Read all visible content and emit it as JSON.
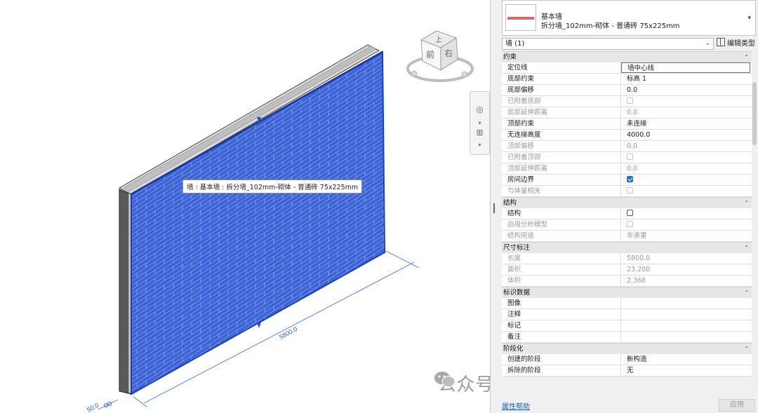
{
  "viewport": {
    "tooltip": "墙 : 基本墙 : 拆分墙_102mm-砌体 - 普通砖 75x225mm",
    "dimension_length": "5800.0",
    "dimension_thickness": "50.0",
    "viewcube": {
      "top": "上",
      "front": "前",
      "right": "右"
    },
    "watermark": "公众号 · Revit二次开发教程",
    "colors": {
      "wall_face": "#3d64d6",
      "brick_lines": "#8fa5e8",
      "dimension": "#3f6fd8"
    }
  },
  "properties": {
    "type_family": "基本墙",
    "type_name": "拆分墙_102mm-砌体 - 普通砖 75x225mm",
    "instance_filter": "墙 (1)",
    "edit_type_label": "编辑类型",
    "sections": [
      {
        "title": "约束",
        "rows": [
          {
            "k": "定位线",
            "v": "墙中心线",
            "state": "edit"
          },
          {
            "k": "底部约束",
            "v": "标高 1",
            "state": "normal"
          },
          {
            "k": "底部偏移",
            "v": "0.0",
            "state": "normal"
          },
          {
            "k": "已附着底部",
            "v": "",
            "state": "dim",
            "check": "off"
          },
          {
            "k": "底部延伸距离",
            "v": "0.0",
            "state": "dim"
          },
          {
            "k": "顶部约束",
            "v": "未连接",
            "state": "normal"
          },
          {
            "k": "无连接高度",
            "v": "4000.0",
            "state": "normal"
          },
          {
            "k": "顶部偏移",
            "v": "0.0",
            "state": "dim"
          },
          {
            "k": "已附着顶部",
            "v": "",
            "state": "dim",
            "check": "off"
          },
          {
            "k": "顶部延伸距离",
            "v": "0.0",
            "state": "dim"
          },
          {
            "k": "房间边界",
            "v": "",
            "state": "normal",
            "check": "on"
          },
          {
            "k": "与体量相关",
            "v": "",
            "state": "dim",
            "check": "off"
          }
        ]
      },
      {
        "title": "结构",
        "rows": [
          {
            "k": "结构",
            "v": "",
            "state": "normal",
            "check": "off"
          },
          {
            "k": "启用分析模型",
            "v": "",
            "state": "dim",
            "check": "off"
          },
          {
            "k": "结构用途",
            "v": "非承重",
            "state": "dim"
          }
        ]
      },
      {
        "title": "尺寸标注",
        "rows": [
          {
            "k": "长度",
            "v": "5800.0",
            "state": "dim"
          },
          {
            "k": "面积",
            "v": "23.200",
            "state": "dim"
          },
          {
            "k": "体积",
            "v": "2.366",
            "state": "dim"
          }
        ]
      },
      {
        "title": "标识数据",
        "rows": [
          {
            "k": "图像",
            "v": "",
            "state": "normal"
          },
          {
            "k": "注释",
            "v": "",
            "state": "normal"
          },
          {
            "k": "标记",
            "v": "",
            "state": "normal"
          },
          {
            "k": "备注",
            "v": "",
            "state": "normal"
          }
        ]
      },
      {
        "title": "阶段化",
        "rows": [
          {
            "k": "创建的阶段",
            "v": "新构造",
            "state": "normal"
          },
          {
            "k": "拆除的阶段",
            "v": "无",
            "state": "normal"
          }
        ]
      }
    ],
    "help_link": "属性帮助",
    "apply_button": "应用"
  }
}
